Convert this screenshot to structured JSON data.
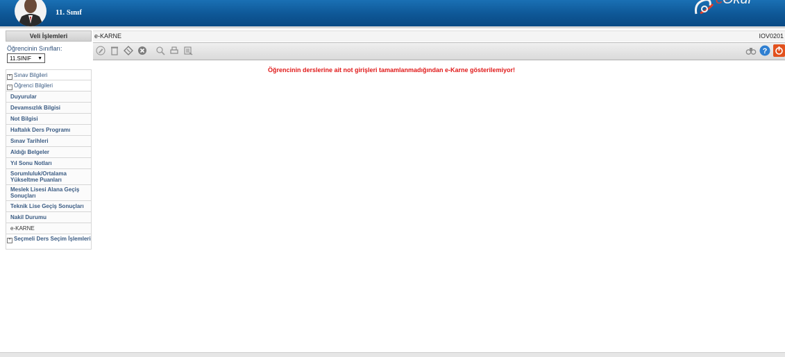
{
  "header": {
    "grade": "11. Sınıf",
    "logo_text": "Okul",
    "logo_prefix": "e-"
  },
  "sidebar": {
    "title": "Veli İşlemleri",
    "class_label": "Öğrencinin Sınıfları:",
    "class_value": "11.SINIF",
    "groups": [
      {
        "label": "Sınav Bilgileri"
      },
      {
        "label": "Öğrenci Bilgileri"
      }
    ],
    "items": [
      "Duyurular",
      "Devamsızlık Bilgisi",
      "Not Bilgisi",
      "Haftalık Ders Programı",
      "Sınav Tarihleri",
      "Aldığı Belgeler",
      "Yıl Sonu Notları",
      "Sorumluluk/Ortalama Yükseltme Puanları",
      "Meslek Lisesi Alana Geçiş Sonuçları",
      "Teknik Lise Geçiş Sonuçları",
      "Nakil Durumu",
      "e-KARNE"
    ],
    "last_group": "Seçmeli Ders Seçim İşlemleri"
  },
  "content": {
    "title": "e-KARNE",
    "code": "IOV0201",
    "message": "Öğrencinin derslerine ait not girişleri tamamlanmadığından e-Karne gösterilemiyor!"
  },
  "toolbar": {
    "icons": [
      "edit-icon",
      "delete-icon",
      "diamond-icon",
      "cancel-icon",
      "search-icon",
      "print-icon",
      "export-icon",
      "binoculars-icon",
      "help-icon",
      "exit-icon"
    ]
  },
  "colors": {
    "header_blue": "#0e5796",
    "message_red": "#e01919",
    "help_blue": "#2f7fd1",
    "exit_orange": "#e2511d"
  }
}
